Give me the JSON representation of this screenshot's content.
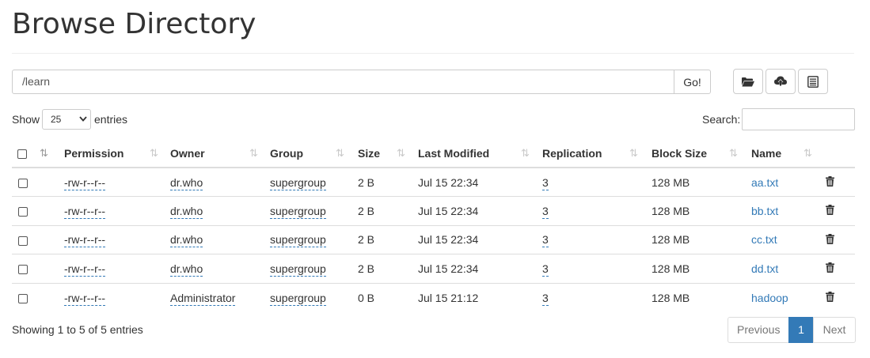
{
  "page": {
    "title": "Browse Directory"
  },
  "path_bar": {
    "value": "/learn",
    "go_label": "Go!"
  },
  "toolbar": {
    "buttons": [
      {
        "icon": "folder-open-icon"
      },
      {
        "icon": "upload-icon"
      },
      {
        "icon": "list-icon"
      }
    ]
  },
  "length_control": {
    "show_label": "Show",
    "selected": "25",
    "entries_label": "entries"
  },
  "search": {
    "label": "Search:"
  },
  "table": {
    "columns": [
      "Permission",
      "Owner",
      "Group",
      "Size",
      "Last Modified",
      "Replication",
      "Block Size",
      "Name"
    ],
    "rows": [
      {
        "permission": "-rw-r--r--",
        "owner": "dr.who",
        "group": "supergroup",
        "size": "2 B",
        "modified": "Jul 15 22:34",
        "replication": "3",
        "block_size": "128 MB",
        "name": "aa.txt"
      },
      {
        "permission": "-rw-r--r--",
        "owner": "dr.who",
        "group": "supergroup",
        "size": "2 B",
        "modified": "Jul 15 22:34",
        "replication": "3",
        "block_size": "128 MB",
        "name": "bb.txt"
      },
      {
        "permission": "-rw-r--r--",
        "owner": "dr.who",
        "group": "supergroup",
        "size": "2 B",
        "modified": "Jul 15 22:34",
        "replication": "3",
        "block_size": "128 MB",
        "name": "cc.txt"
      },
      {
        "permission": "-rw-r--r--",
        "owner": "dr.who",
        "group": "supergroup",
        "size": "2 B",
        "modified": "Jul 15 22:34",
        "replication": "3",
        "block_size": "128 MB",
        "name": "dd.txt"
      },
      {
        "permission": "-rw-r--r--",
        "owner": "Administrator",
        "group": "supergroup",
        "size": "0 B",
        "modified": "Jul 15 21:12",
        "replication": "3",
        "block_size": "128 MB",
        "name": "hadoop"
      }
    ]
  },
  "footer": {
    "info": "Showing 1 to 5 of 5 entries",
    "pagination": {
      "previous": "Previous",
      "current": "1",
      "next": "Next"
    }
  },
  "colors": {
    "link": "#337ab7",
    "active_page": "#337ab7",
    "border": "#dddddd"
  }
}
